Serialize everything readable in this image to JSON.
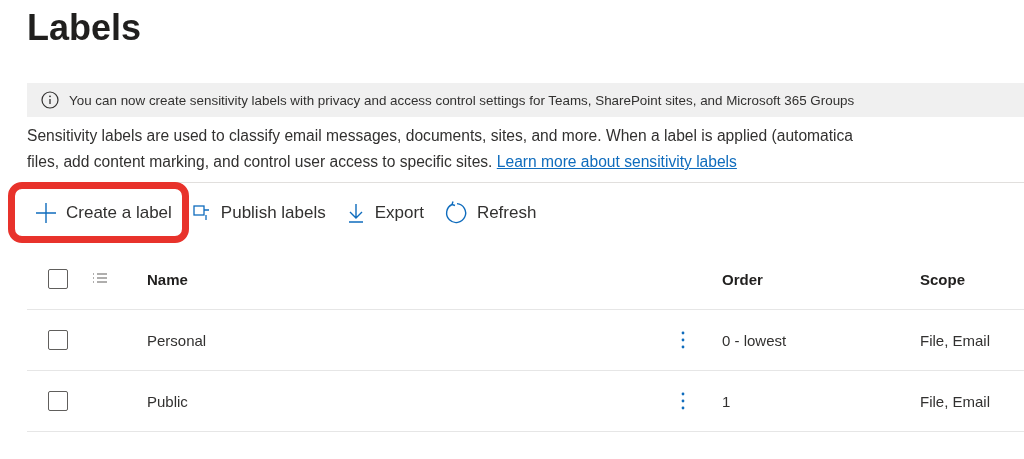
{
  "title": "Labels",
  "banner": {
    "text": "You can now create sensitivity labels with privacy and access control settings for Teams, SharePoint sites, and Microsoft 365 Groups"
  },
  "description": {
    "lines": [
      "Sensitivity labels are used to classify email messages, documents, sites, and more. When a label is applied (automatica",
      "files, add content marking, and control user access to specific sites."
    ],
    "link": "Learn more about sensitivity labels"
  },
  "toolbar": [
    {
      "kind": "create",
      "label": "Create a label",
      "highlighted": true
    },
    {
      "kind": "publish",
      "label": "Publish labels",
      "highlighted": false
    },
    {
      "kind": "export",
      "label": "Export",
      "highlighted": false
    },
    {
      "kind": "refresh",
      "label": "Refresh",
      "highlighted": false
    }
  ],
  "table": {
    "columns": [
      "Name",
      "Order",
      "Scope"
    ],
    "select_all": {
      "checked": false
    },
    "rows": [
      {
        "name": "Personal",
        "order": "0 - lowest",
        "scope": "File, Email",
        "checked": false
      },
      {
        "name": "Public",
        "order": "1",
        "scope": "File, Email",
        "checked": false
      }
    ]
  }
}
